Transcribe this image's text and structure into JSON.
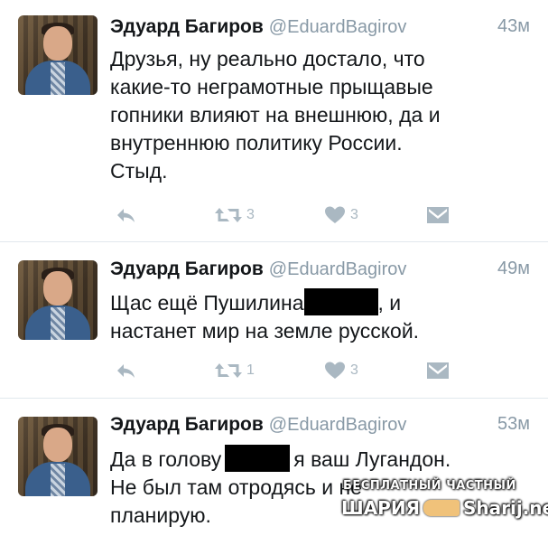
{
  "tweets": [
    {
      "name": "Эдуард Багиров",
      "handle": "@EduardBagirov",
      "time": "43м",
      "lines": [
        "Друзья, ну реально достало, что",
        "какие-то неграмотные прыщавые",
        "гопники влияют на внешнюю, да и",
        "внутреннюю политику России.",
        "Стыд."
      ],
      "retweets": "3",
      "likes": "3"
    },
    {
      "name": "Эдуард Багиров",
      "handle": "@EduardBagirov",
      "time": "49м",
      "line1_before": "Щас ещё Пушилина",
      "line1_after": ", и",
      "line2": "настанет мир на земле русской.",
      "retweets": "1",
      "likes": "3"
    },
    {
      "name": "Эдуард Багиров",
      "handle": "@EduardBagirov",
      "time": "53м",
      "line1_before": "Да в голову",
      "line1_after": "я ваш Лугандон.",
      "line2": "Не был там отродясь и не",
      "line3": "планирую."
    }
  ],
  "watermark": {
    "top": "БЕСПЛАТНЫЙ ЧАСТНЫЙ",
    "left": "ШАРИЯ",
    "right": "Sharij.net"
  },
  "icons": {
    "reply": "reply-arrow-icon",
    "retweet": "retweet-icon",
    "like": "heart-icon",
    "dm": "direct-message-icon"
  },
  "colors": {
    "text": "#14171a",
    "muted": "#8899a6",
    "icon": "#aab8c2",
    "divider": "#e1e8ed",
    "redaction": "#000000"
  }
}
